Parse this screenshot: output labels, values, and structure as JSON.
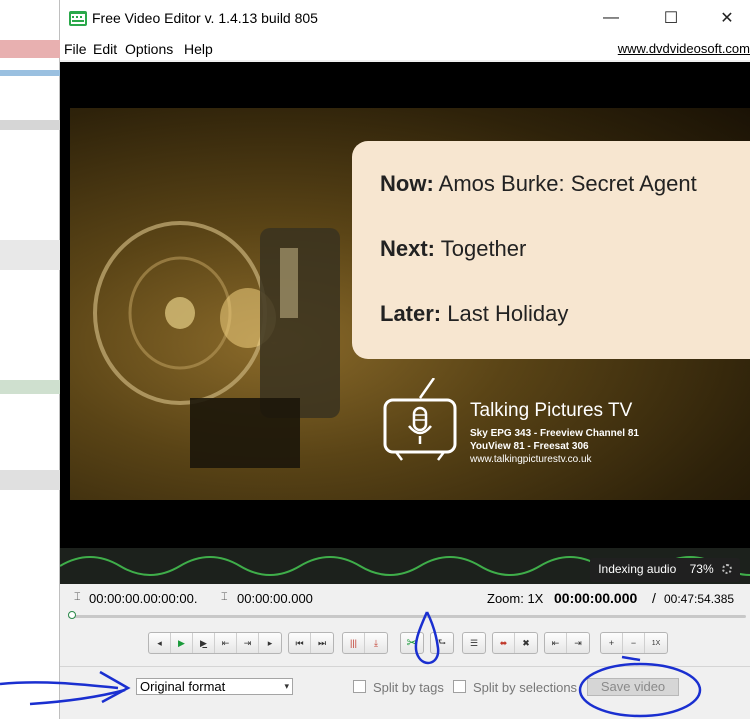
{
  "window": {
    "title": "Free Video Editor v. 1.4.13 build 805",
    "minimize_glyph": "—",
    "maximize_glyph": "☐",
    "close_glyph": "✕"
  },
  "menu": {
    "items": [
      "File",
      "Edit",
      "Options",
      "Help"
    ],
    "site_link": "www.dvdvideosoft.com"
  },
  "video": {
    "now_label": "Now:",
    "now_value": "Amos Burke: Secret Agent",
    "next_label": "Next:",
    "next_value": "Together",
    "later_label": "Later:",
    "later_value": "Last Holiday",
    "logo_name": "Talking Pictures TV",
    "logo_line1": "Sky EPG 343 - Freeview Channel 81",
    "logo_line2": "YouView 81 - Freesat 306",
    "logo_line3": "www.talkingpicturestv.co.uk"
  },
  "waveform": {
    "indexing_text": "Indexing audio",
    "indexing_percent": "73%",
    "progress": 0.73
  },
  "timeline": {
    "sel_start": "00:00:00.00:00:00.",
    "sel_end": "00:00:00.000",
    "zoom_label": "Zoom: 1X",
    "current_time": "00:00:00.000",
    "separator": "/",
    "total_time": "00:47:54.385"
  },
  "toolbar": {
    "group1": [
      "◂",
      "▶",
      "▶̲",
      "⇤",
      "⇥",
      "▸"
    ],
    "group2": [
      "⏮",
      "⏭"
    ],
    "group3": [
      "|||",
      "⤓"
    ],
    "cut": "✂",
    "rotate": "⮑",
    "adjust": "☰",
    "group4": [
      "⬌",
      "✖"
    ],
    "group5": [
      "⇤",
      "⇥"
    ],
    "zoom": [
      "+",
      "−",
      "1X"
    ]
  },
  "bottom": {
    "format": "Original format",
    "split_by_tags": "Split by tags",
    "split_by_selections": "Split by selections",
    "save_video": "Save video"
  },
  "colors": {
    "accent_green": "#1a9a3a",
    "annotation_blue": "#1a2fd0",
    "info_panel": "#f7e6d0"
  }
}
